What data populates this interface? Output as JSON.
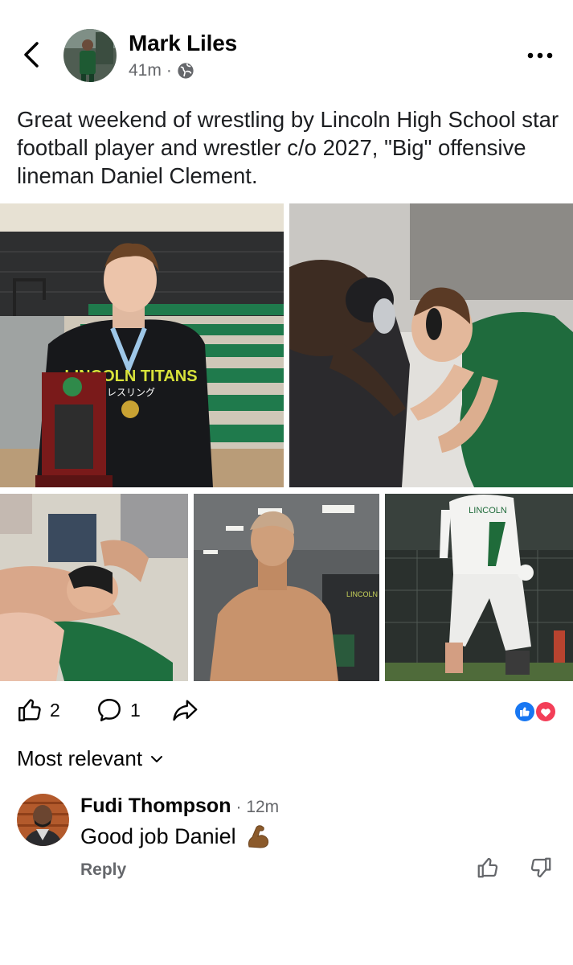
{
  "post": {
    "author": "Mark Liles",
    "time": "41m",
    "separator": "·",
    "text": "Great weekend of wrestling by Lincoln High School star football player and wrestler c/o 2027, \"Big\" offensive lineman Daniel Clement."
  },
  "photo_texts": {
    "hoodie_line1": "LINCOLN TITANS",
    "hoodie_line2": "レスリング",
    "jersey": "LINCOLN",
    "wall": "LINCOLN"
  },
  "actions": {
    "like_count": "2",
    "comment_count": "1"
  },
  "comments_sort": {
    "label": "Most relevant"
  },
  "comment": {
    "author": "Fudi Thompson",
    "separator": "·",
    "time": "12m",
    "text": "Good job Daniel",
    "reply": "Reply"
  },
  "icons": {
    "back": "chevron-left-icon",
    "more": "more-horizontal-icon",
    "privacy": "globe-icon",
    "like": "thumbs-up-icon",
    "comment": "comment-icon",
    "share": "share-icon",
    "reaction_like": "like-reaction-icon",
    "reaction_love": "love-reaction-icon",
    "sort": "chevron-down-icon",
    "emoji": "flexed-biceps-icon",
    "comment_like": "thumbs-up-icon",
    "comment_dislike": "thumbs-down-icon"
  },
  "colors": {
    "text": "#050505",
    "secondary": "#65676b",
    "like_blue": "#1877f2",
    "love_red": "#f33e58",
    "titans_green": "#1e6b3a"
  }
}
